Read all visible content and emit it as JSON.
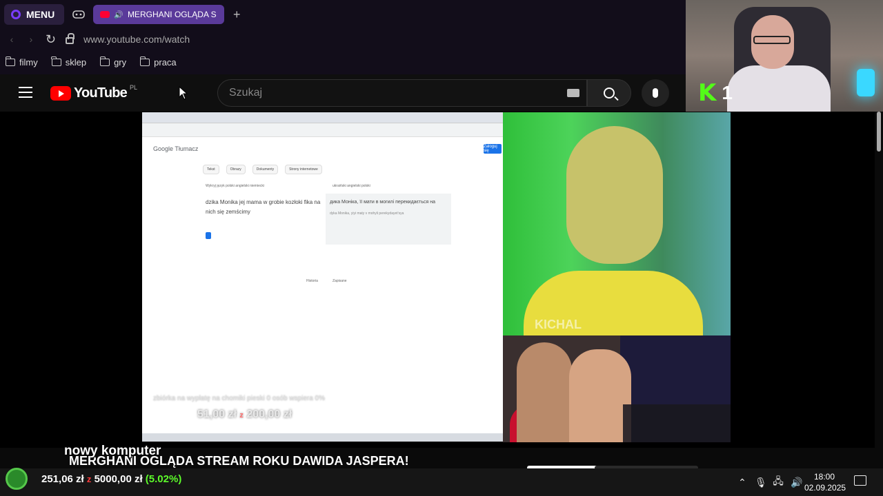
{
  "browser": {
    "menu_label": "MENU",
    "tab_title": "MERGHANI OGLĄDA S",
    "url": "www.youtube.com/watch",
    "bookmarks": [
      {
        "label": "filmy"
      },
      {
        "label": "sklep"
      },
      {
        "label": "gry"
      },
      {
        "label": "praca"
      }
    ]
  },
  "youtube": {
    "logo_text": "YouTube",
    "country_code": "PL",
    "search_placeholder": "Szukaj",
    "video_title": "MERGHANI OGLĄDA STREAM ROKU DAWIDA JASPERA!"
  },
  "webcam": {
    "kick_logo": "K",
    "viewer_count": "1"
  },
  "video_content": {
    "translate_title": "Google Tłumacz",
    "translate_sign_in": "Zaloguj się",
    "mode_chips": [
      "Tekst",
      "Obrazy",
      "Dokumenty",
      "Strony internetowe"
    ],
    "source_langs": "Wykryj język   polski   angielski   niemiecki",
    "target_langs": "ukraiński   angielski   polski",
    "source_text": "dzika Monika jej mama w grobie kozłoki fika na nich się zemścimy",
    "target_text": "дика Моніка, її мати в могилі перекидається на",
    "translit_text": "dyka Monika, yiyi maty v mohyli perekydayetʹsya",
    "history_label": "Historia",
    "saved_label": "Zapisane",
    "goal_overlay": "zbiórka na wypłatę na chomiki pieski 0 osób wspiera 0%",
    "goal_amount": "51,00 zł",
    "goal_of": "z",
    "goal_target": "200,00 zł",
    "cam_watermark": "KICHAL"
  },
  "overlay": {
    "new_pc_label": "nowy komputer",
    "donation_current": "251,06 zł",
    "donation_of": "z",
    "donation_target": "5000,00 zł",
    "donation_percent": "(5.02%)"
  },
  "taskbar": {
    "time": "18:00",
    "date": "02.09.2025",
    "tray_icons": [
      "chevron-up-icon",
      "microphone-icon",
      "network-icon",
      "speaker-icon"
    ]
  },
  "colors": {
    "youtube_red": "#ff0000",
    "kick_green": "#53fc18",
    "tab_purple": "#5a3a9a",
    "percent_green": "#5dfc2a"
  }
}
